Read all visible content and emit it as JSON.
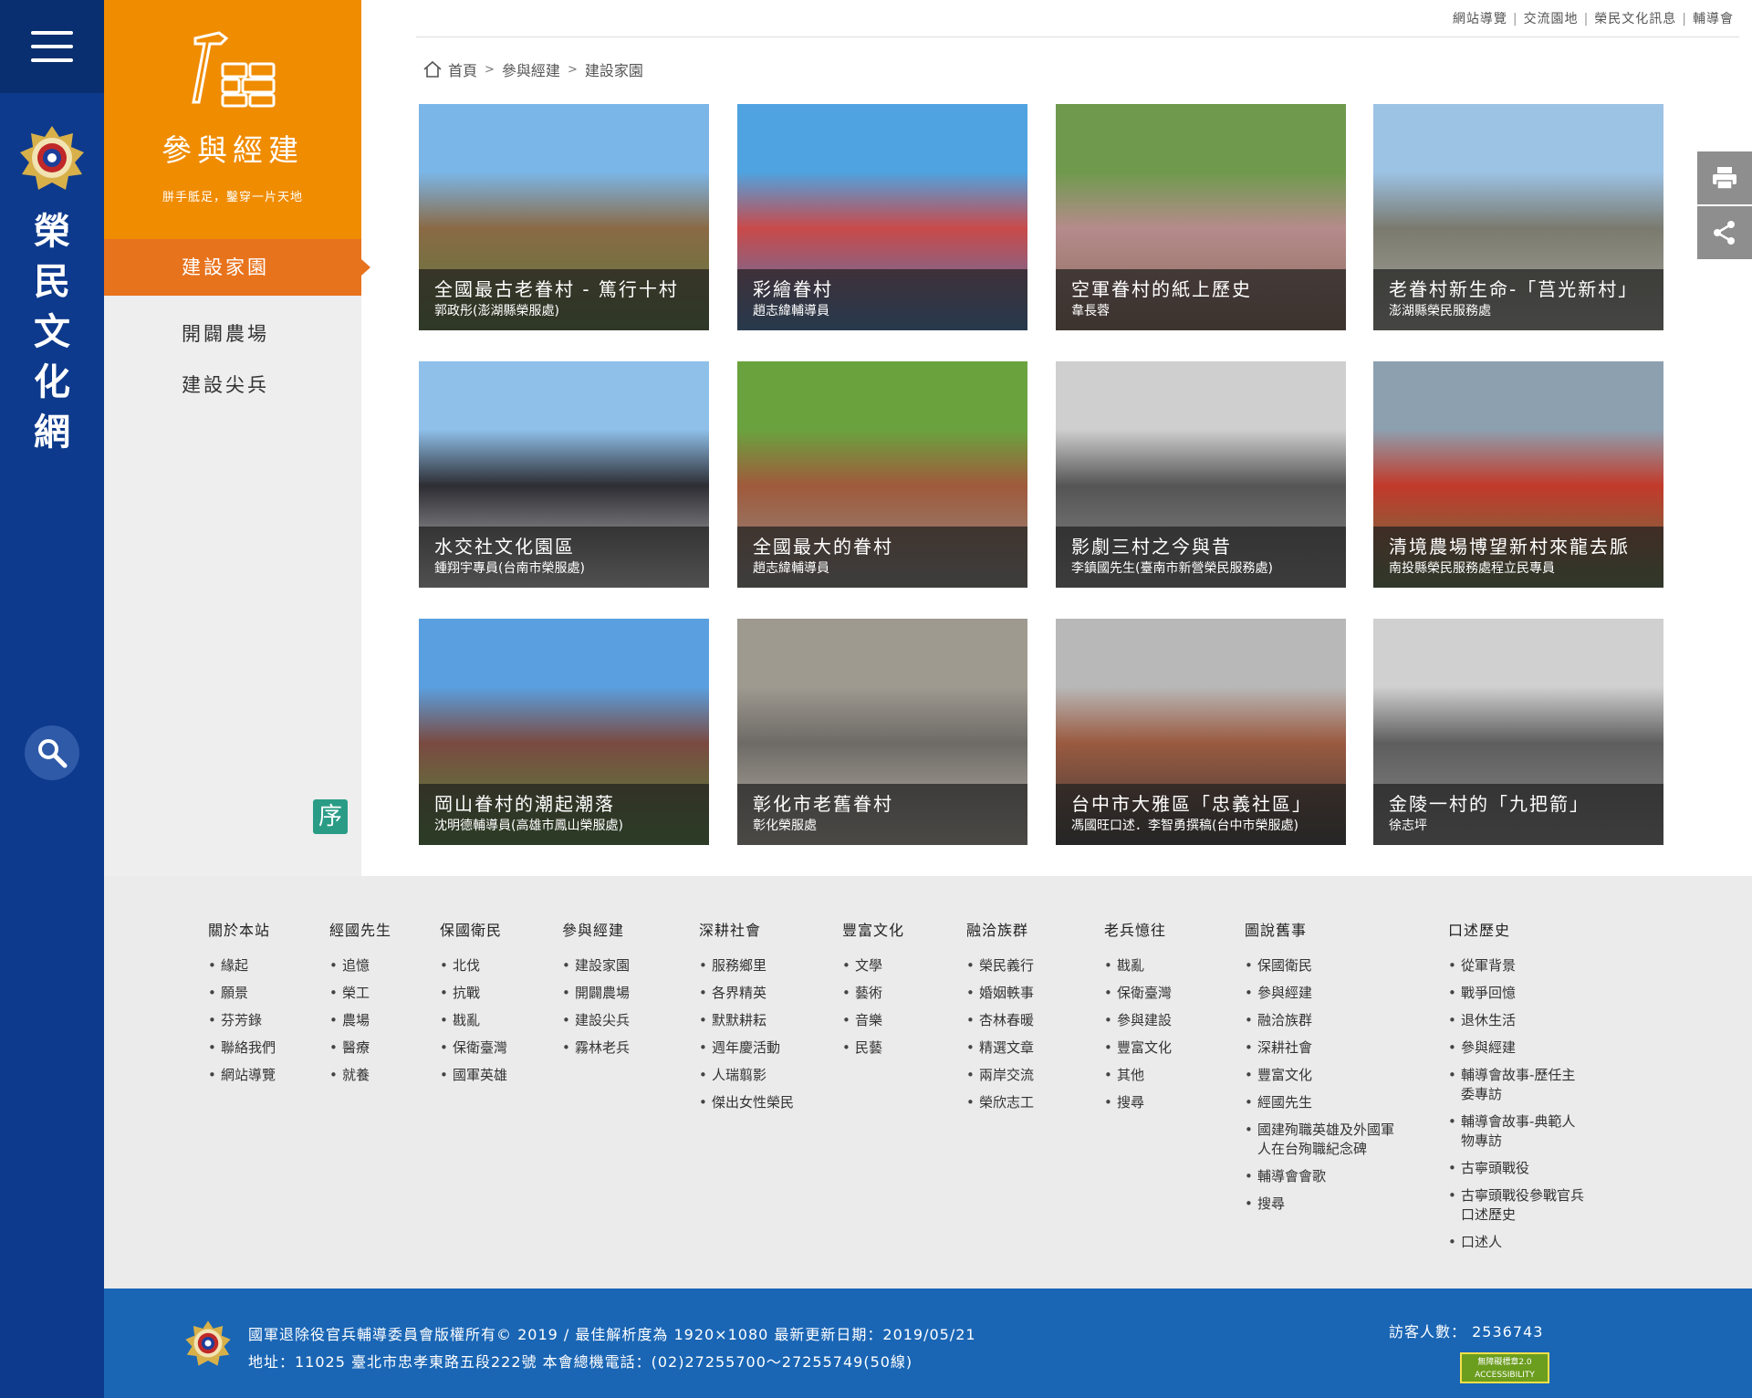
{
  "site": {
    "title_chars": [
      "榮",
      "民",
      "文",
      "化",
      "網"
    ]
  },
  "section": {
    "name": "參與經建",
    "slogan": "胼手胝足，鑿穿一片天地",
    "menu": [
      {
        "label": "建設家園",
        "active": true
      },
      {
        "label": "開闢農場",
        "active": false
      },
      {
        "label": "建設尖兵",
        "active": false
      }
    ],
    "preface_label": "序"
  },
  "top_links": [
    "網站導覽",
    "交流園地",
    "榮民文化訊息",
    "輔導會"
  ],
  "breadcrumb": [
    "首頁",
    "參與經建",
    "建設家園"
  ],
  "cards": [
    {
      "title": "全國最古老眷村 - 篤行十村",
      "author": "郭政彤(澎湖縣榮服處)",
      "palette": [
        "#7bb6e8",
        "#8a6a45",
        "#5a7a3c"
      ]
    },
    {
      "title": "彩繪眷村",
      "author": "趙志緯輔導員",
      "palette": [
        "#4fa3e0",
        "#c94a4a",
        "#3f7fc4"
      ]
    },
    {
      "title": "空軍眷村的紙上歷史",
      "author": "韋長蓉",
      "palette": [
        "#6f9a4e",
        "#b58b8b",
        "#8a6a5a"
      ]
    },
    {
      "title": "老眷村新生命-「莒光新村」",
      "author": "澎湖縣榮民服務處",
      "palette": [
        "#9cc2e4",
        "#7a7a6e",
        "#a9a9a0"
      ]
    },
    {
      "title": "水交社文化園區",
      "author": "鍾翔宇專員(台南市榮服處)",
      "palette": [
        "#8fc0ea",
        "#2d2d33",
        "#cfcfcf"
      ]
    },
    {
      "title": "全國最大的眷村",
      "author": "趙志緯輔導員",
      "palette": [
        "#6aa33e",
        "#a05a3c",
        "#8f8f8a"
      ]
    },
    {
      "title": "影劇三村之今與昔",
      "author": "李鎮國先生(臺南市新營榮民服務處)",
      "palette": [
        "#cfcfcf",
        "#555555",
        "#8a8a8a"
      ]
    },
    {
      "title": "清境農場博望新村來龍去脈",
      "author": "南投縣榮民服務處程立民專員",
      "palette": [
        "#8da0b0",
        "#c23a2a",
        "#5e7a4a"
      ]
    },
    {
      "title": "岡山眷村的潮起潮落",
      "author": "沈明德輔導員(高雄市鳳山榮服處)",
      "palette": [
        "#5aa0e0",
        "#7a4a40",
        "#4f8a3a"
      ]
    },
    {
      "title": "彰化市老舊眷村",
      "author": "彰化榮服處",
      "palette": [
        "#9e9a90",
        "#6e6a66",
        "#bdb7ab"
      ]
    },
    {
      "title": "台中市大雅區「忠義社區」",
      "author": "馮國旺口述．李智勇撰稿(台中市榮服處)",
      "palette": [
        "#b8b8b8",
        "#9a5a40",
        "#3a3a3a"
      ]
    },
    {
      "title": "金陵一村的「九把箭」",
      "author": "徐志坪",
      "palette": [
        "#d0d0d0",
        "#5e5e5e",
        "#8a8a8a"
      ]
    }
  ],
  "footer_nav": [
    {
      "head": "關於本站",
      "items": [
        "緣起",
        "願景",
        "芬芳錄",
        "聯絡我們",
        "網站導覽"
      ]
    },
    {
      "head": "經國先生",
      "items": [
        "追憶",
        "榮工",
        "農場",
        "醫療",
        "就養"
      ]
    },
    {
      "head": "保國衛民",
      "items": [
        "北伐",
        "抗戰",
        "戡亂",
        "保衛臺灣",
        "國軍英雄"
      ]
    },
    {
      "head": "參與經建",
      "items": [
        "建設家園",
        "開闢農場",
        "建設尖兵",
        "霧林老兵"
      ]
    },
    {
      "head": "深耕社會",
      "items": [
        "服務鄉里",
        "各界精英",
        "默默耕耘",
        "週年慶活動",
        "人瑞翦影",
        "傑出女性榮民"
      ]
    },
    {
      "head": "豐富文化",
      "items": [
        "文學",
        "藝術",
        "音樂",
        "民藝"
      ]
    },
    {
      "head": "融洽族群",
      "items": [
        "榮民義行",
        "婚姻軼事",
        "杏林春暖",
        "精選文章",
        "兩岸交流",
        "榮欣志工"
      ]
    },
    {
      "head": "老兵憶往",
      "items": [
        "戡亂",
        "保衛臺灣",
        "參與建設",
        "豐富文化",
        "其他",
        "搜尋"
      ]
    },
    {
      "head": "圖說舊事",
      "items": [
        "保國衛民",
        "參與經建",
        "融洽族群",
        "深耕社會",
        "豐富文化",
        "經國先生",
        "國建殉職英雄及外國軍人在台殉職紀念碑",
        "輔導會會歌",
        "搜尋"
      ]
    },
    {
      "head": "口述歷史",
      "items": [
        "從軍背景",
        "戰爭回憶",
        "退休生活",
        "參與經建",
        "輔導會故事-歷任主委專訪",
        "輔導會故事-典範人物專訪",
        "古寧頭戰役",
        "古寧頭戰役參戰官兵口述歷史",
        "口述人"
      ]
    }
  ],
  "footer": {
    "copyright": "國軍退除役官兵輔導委員會版權所有© 2019  /  最佳解析度為 1920×1080   最新更新日期：2019/05/21",
    "address": "地址：11025 臺北市忠孝東路五段222號    本會總機電話：(02)27255700～27255749(50線)",
    "visitor_label": "訪客人數：",
    "visitor_count": "2536743",
    "badge_label": "無障礙標章2.0",
    "badge_sub": "ACCESSIBILITY"
  },
  "colors": {
    "rail": "#0d3a8c",
    "section_orange": "#f08c00",
    "active_menu": "#e8731d",
    "footer_blue": "#1a66b5",
    "preface_green": "#2a9c86"
  }
}
